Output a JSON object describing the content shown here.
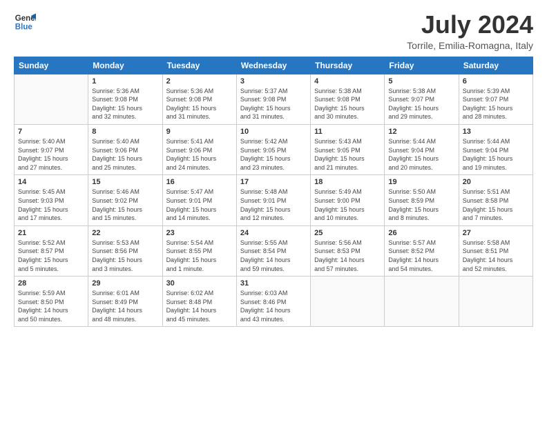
{
  "header": {
    "logo_line1": "General",
    "logo_line2": "Blue",
    "main_title": "July 2024",
    "subtitle": "Torrile, Emilia-Romagna, Italy"
  },
  "weekdays": [
    "Sunday",
    "Monday",
    "Tuesday",
    "Wednesday",
    "Thursday",
    "Friday",
    "Saturday"
  ],
  "weeks": [
    [
      {
        "day": "",
        "info": ""
      },
      {
        "day": "1",
        "info": "Sunrise: 5:36 AM\nSunset: 9:08 PM\nDaylight: 15 hours\nand 32 minutes."
      },
      {
        "day": "2",
        "info": "Sunrise: 5:36 AM\nSunset: 9:08 PM\nDaylight: 15 hours\nand 31 minutes."
      },
      {
        "day": "3",
        "info": "Sunrise: 5:37 AM\nSunset: 9:08 PM\nDaylight: 15 hours\nand 31 minutes."
      },
      {
        "day": "4",
        "info": "Sunrise: 5:38 AM\nSunset: 9:08 PM\nDaylight: 15 hours\nand 30 minutes."
      },
      {
        "day": "5",
        "info": "Sunrise: 5:38 AM\nSunset: 9:07 PM\nDaylight: 15 hours\nand 29 minutes."
      },
      {
        "day": "6",
        "info": "Sunrise: 5:39 AM\nSunset: 9:07 PM\nDaylight: 15 hours\nand 28 minutes."
      }
    ],
    [
      {
        "day": "7",
        "info": "Sunrise: 5:40 AM\nSunset: 9:07 PM\nDaylight: 15 hours\nand 27 minutes."
      },
      {
        "day": "8",
        "info": "Sunrise: 5:40 AM\nSunset: 9:06 PM\nDaylight: 15 hours\nand 25 minutes."
      },
      {
        "day": "9",
        "info": "Sunrise: 5:41 AM\nSunset: 9:06 PM\nDaylight: 15 hours\nand 24 minutes."
      },
      {
        "day": "10",
        "info": "Sunrise: 5:42 AM\nSunset: 9:05 PM\nDaylight: 15 hours\nand 23 minutes."
      },
      {
        "day": "11",
        "info": "Sunrise: 5:43 AM\nSunset: 9:05 PM\nDaylight: 15 hours\nand 21 minutes."
      },
      {
        "day": "12",
        "info": "Sunrise: 5:44 AM\nSunset: 9:04 PM\nDaylight: 15 hours\nand 20 minutes."
      },
      {
        "day": "13",
        "info": "Sunrise: 5:44 AM\nSunset: 9:04 PM\nDaylight: 15 hours\nand 19 minutes."
      }
    ],
    [
      {
        "day": "14",
        "info": "Sunrise: 5:45 AM\nSunset: 9:03 PM\nDaylight: 15 hours\nand 17 minutes."
      },
      {
        "day": "15",
        "info": "Sunrise: 5:46 AM\nSunset: 9:02 PM\nDaylight: 15 hours\nand 15 minutes."
      },
      {
        "day": "16",
        "info": "Sunrise: 5:47 AM\nSunset: 9:01 PM\nDaylight: 15 hours\nand 14 minutes."
      },
      {
        "day": "17",
        "info": "Sunrise: 5:48 AM\nSunset: 9:01 PM\nDaylight: 15 hours\nand 12 minutes."
      },
      {
        "day": "18",
        "info": "Sunrise: 5:49 AM\nSunset: 9:00 PM\nDaylight: 15 hours\nand 10 minutes."
      },
      {
        "day": "19",
        "info": "Sunrise: 5:50 AM\nSunset: 8:59 PM\nDaylight: 15 hours\nand 8 minutes."
      },
      {
        "day": "20",
        "info": "Sunrise: 5:51 AM\nSunset: 8:58 PM\nDaylight: 15 hours\nand 7 minutes."
      }
    ],
    [
      {
        "day": "21",
        "info": "Sunrise: 5:52 AM\nSunset: 8:57 PM\nDaylight: 15 hours\nand 5 minutes."
      },
      {
        "day": "22",
        "info": "Sunrise: 5:53 AM\nSunset: 8:56 PM\nDaylight: 15 hours\nand 3 minutes."
      },
      {
        "day": "23",
        "info": "Sunrise: 5:54 AM\nSunset: 8:55 PM\nDaylight: 15 hours\nand 1 minute."
      },
      {
        "day": "24",
        "info": "Sunrise: 5:55 AM\nSunset: 8:54 PM\nDaylight: 14 hours\nand 59 minutes."
      },
      {
        "day": "25",
        "info": "Sunrise: 5:56 AM\nSunset: 8:53 PM\nDaylight: 14 hours\nand 57 minutes."
      },
      {
        "day": "26",
        "info": "Sunrise: 5:57 AM\nSunset: 8:52 PM\nDaylight: 14 hours\nand 54 minutes."
      },
      {
        "day": "27",
        "info": "Sunrise: 5:58 AM\nSunset: 8:51 PM\nDaylight: 14 hours\nand 52 minutes."
      }
    ],
    [
      {
        "day": "28",
        "info": "Sunrise: 5:59 AM\nSunset: 8:50 PM\nDaylight: 14 hours\nand 50 minutes."
      },
      {
        "day": "29",
        "info": "Sunrise: 6:01 AM\nSunset: 8:49 PM\nDaylight: 14 hours\nand 48 minutes."
      },
      {
        "day": "30",
        "info": "Sunrise: 6:02 AM\nSunset: 8:48 PM\nDaylight: 14 hours\nand 45 minutes."
      },
      {
        "day": "31",
        "info": "Sunrise: 6:03 AM\nSunset: 8:46 PM\nDaylight: 14 hours\nand 43 minutes."
      },
      {
        "day": "",
        "info": ""
      },
      {
        "day": "",
        "info": ""
      },
      {
        "day": "",
        "info": ""
      }
    ]
  ]
}
